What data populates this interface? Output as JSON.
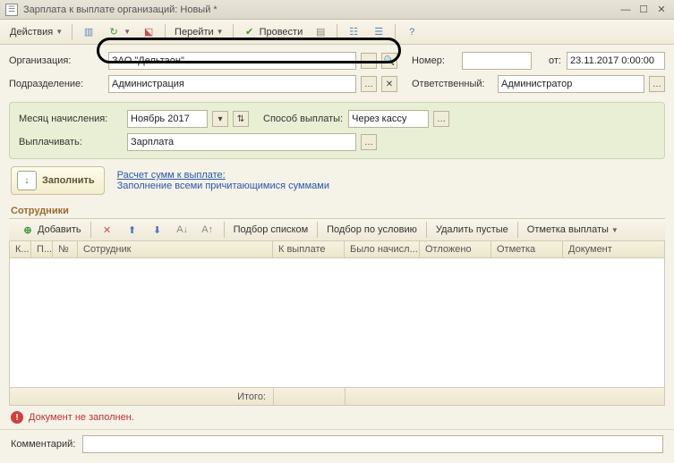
{
  "title": "Зарплата к выплате организаций: Новый *",
  "toolbar": {
    "actions": "Действия",
    "goto": "Перейти",
    "post": "Провести"
  },
  "labels": {
    "org": "Организация:",
    "dept": "Подразделение:",
    "number": "Номер:",
    "from": "от:",
    "resp": "Ответственный:",
    "month": "Месяц начисления:",
    "method": "Способ выплаты:",
    "pay": "Выплачивать:",
    "comment": "Комментарий:"
  },
  "values": {
    "org": "ЗАО \"Дельтаон\"",
    "dept": "Администрация",
    "number": "",
    "date": "23.11.2017 0:00:00",
    "resp": "Администратор",
    "month": "Ноябрь 2017",
    "method": "Через кассу",
    "pay": "Зарплата",
    "comment": ""
  },
  "fill": {
    "button": "Заполнить",
    "link1": "Расчет сумм к выплате:",
    "link2": "Заполнение всеми причитающимися суммами"
  },
  "section": "Сотрудники",
  "grid_toolbar": {
    "add": "Добавить",
    "pick_list": "Подбор списком",
    "pick_cond": "Подбор по условию",
    "del_empty": "Удалить пустые",
    "mark": "Отметка выплаты"
  },
  "columns": {
    "c1": "К...",
    "c2": "П...",
    "c3": "№",
    "c4": "Сотрудник",
    "c5": "К выплате",
    "c6": "Было начисл...",
    "c7": "Отложено",
    "c8": "Отметка",
    "c9": "Документ"
  },
  "totals_label": "Итого:",
  "error": "Документ не заполнен."
}
